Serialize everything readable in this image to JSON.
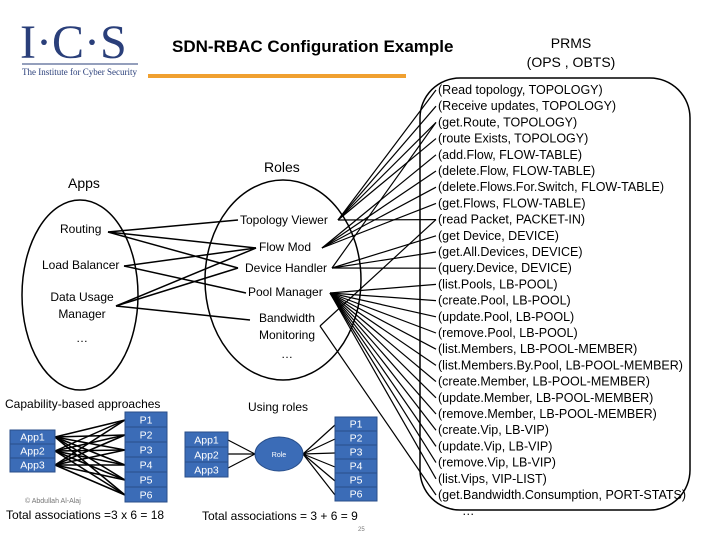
{
  "logo": {
    "letters": "I·C·S",
    "tagline": "The Institute for Cyber Security"
  },
  "title": "SDN-RBAC Configuration Example",
  "prms": {
    "line1": "PRMS",
    "line2": "(OPS , OBTS)"
  },
  "apps": {
    "heading": "Apps",
    "items": [
      "Routing",
      "Load Balancer",
      "Data Usage",
      "Manager"
    ],
    "more": "…"
  },
  "roles": {
    "heading": "Roles",
    "items": [
      "Topology Viewer",
      "Flow Mod",
      "Device Handler",
      "Pool Manager",
      "Bandwidth",
      "Monitoring"
    ],
    "more": "…"
  },
  "permissions": [
    "(Read topology, TOPOLOGY)",
    "(Receive updates, TOPOLOGY)",
    "(get.Route, TOPOLOGY)",
    "(route Exists, TOPOLOGY)",
    "(add.Flow, FLOW-TABLE)",
    "(delete.Flow, FLOW-TABLE)",
    "(delete.Flows.For.Switch, FLOW-TABLE)",
    "(get.Flows, FLOW-TABLE)",
    "(read Packet, PACKET-IN)",
    "(get Device, DEVICE)",
    "(get.All.Devices, DEVICE)",
    "(query.Device, DEVICE)",
    "(list.Pools, LB-POOL)",
    "(create.Pool, LB-POOL)",
    "(update.Pool, LB-POOL)",
    "(remove.Pool, LB-POOL)",
    "(list.Members, LB-POOL-MEMBER)",
    "(list.Members.By.Pool, LB-POOL-MEMBER)",
    "(create.Member, LB-POOL-MEMBER)",
    "(update.Member, LB-POOL-MEMBER)",
    "(remove.Member, LB-POOL-MEMBER)",
    "(create.Vip, LB-VIP)",
    "(update.Vip, LB-VIP)",
    "(remove.Vip, LB-VIP)",
    "(list.Vips, VIP-LIST)",
    "(get.Bandwidth.Consumption, PORT-STATS)"
  ],
  "permissions_more": "…",
  "capability": {
    "heading": "Capability-based approaches",
    "apps": [
      "App1",
      "App2",
      "App3"
    ],
    "perms": [
      "P1",
      "P2",
      "P3",
      "P4",
      "P5",
      "P6"
    ],
    "total": "Total associations =3 x 6 = 18",
    "copyright": "© Abdullah Al-Alaj"
  },
  "using_roles": {
    "heading": "Using roles",
    "apps": [
      "App1",
      "App2",
      "App3"
    ],
    "role": "Role",
    "perms": [
      "P1",
      "P2",
      "P3",
      "P4",
      "P5",
      "P6"
    ],
    "total": "Total associations = 3 + 6 = 9"
  },
  "page_number": "25",
  "colors": {
    "accent": "#f0a030",
    "box": "#3b6cb7",
    "logo": "#2a3f7a"
  }
}
